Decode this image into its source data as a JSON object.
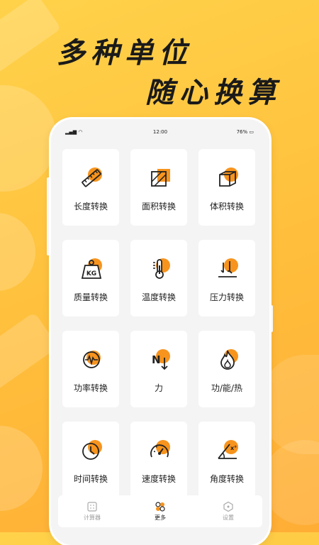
{
  "headline": {
    "line1": "多种单位",
    "line2": "随心换算"
  },
  "status_bar": {
    "time": "12:00",
    "battery": "76%"
  },
  "accent_color": "#f7941d",
  "cards": [
    {
      "label": "长度转换",
      "icon": "ruler-icon"
    },
    {
      "label": "面积转换",
      "icon": "area-square-icon"
    },
    {
      "label": "体积转换",
      "icon": "cube-icon"
    },
    {
      "label": "质量转换",
      "icon": "kg-weight-icon"
    },
    {
      "label": "温度转换",
      "icon": "thermometer-icon"
    },
    {
      "label": "压力转换",
      "icon": "pressure-icon"
    },
    {
      "label": "功率转换",
      "icon": "power-pulse-icon"
    },
    {
      "label": "力",
      "icon": "force-newton-icon"
    },
    {
      "label": "功/能/热",
      "icon": "flame-icon"
    },
    {
      "label": "时间转换",
      "icon": "clock-icon"
    },
    {
      "label": "速度转换",
      "icon": "speedometer-icon"
    },
    {
      "label": "角度转换",
      "icon": "angle-icon"
    }
  ],
  "tabs": [
    {
      "label": "计算器",
      "icon": "calculator-icon",
      "active": false
    },
    {
      "label": "更多",
      "icon": "more-grid-icon",
      "active": true
    },
    {
      "label": "设置",
      "icon": "settings-hex-icon",
      "active": false
    }
  ]
}
